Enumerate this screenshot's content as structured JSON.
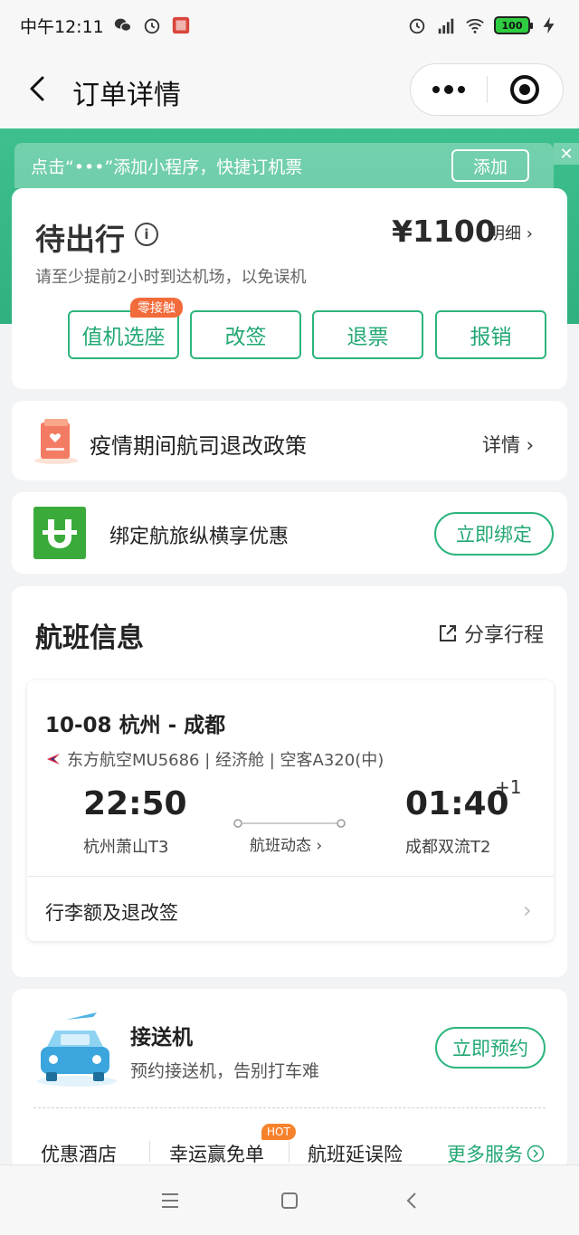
{
  "status_bar": {
    "time": "中午12:11",
    "battery": "100"
  },
  "nav": {
    "title": "订单详情"
  },
  "banner": {
    "text": "点击“•••”添加小程序，快捷订机票",
    "add_label": "添加",
    "close_label": "✕"
  },
  "order": {
    "status": "待出行",
    "price": "¥1100",
    "detail_label": "明细 ›",
    "tip": "请至少提前2小时到达机场，以免误机",
    "actions": [
      {
        "label": "值机选座",
        "badge": "零接触"
      },
      {
        "label": "改签"
      },
      {
        "label": "退票"
      },
      {
        "label": "报销"
      }
    ]
  },
  "policy": {
    "text": "疫情期间航司退改政策",
    "detail_label": "详情 ›"
  },
  "bind": {
    "text": "绑定航旅纵横享优惠",
    "button": "立即绑定"
  },
  "flight": {
    "section_title": "航班信息",
    "share_label": "分享行程",
    "route": "10-08 杭州 - 成都",
    "airline": "东方航空MU5686 | 经济舱 | 空客A320(中)",
    "depart_time": "22:50",
    "depart_airport": "杭州萧山T3",
    "arrive_time": "01:40",
    "arrive_day_offset": "+1",
    "arrive_airport": "成都双流T2",
    "dynamic_label": "航班动态 ›",
    "baggage_label": "行李额及退改签"
  },
  "transfer": {
    "title": "接送机",
    "subtitle": "预约接送机，告别打车难",
    "button": "立即预约",
    "services": [
      "优惠酒店",
      "幸运赢免单",
      "航班延误险"
    ],
    "hot_badge": "HOT",
    "more_label": "更多服务"
  },
  "colors": {
    "brand_green": "#2db57d",
    "header_green": "#3ec08e",
    "badge_orange": "#f26b3a"
  }
}
